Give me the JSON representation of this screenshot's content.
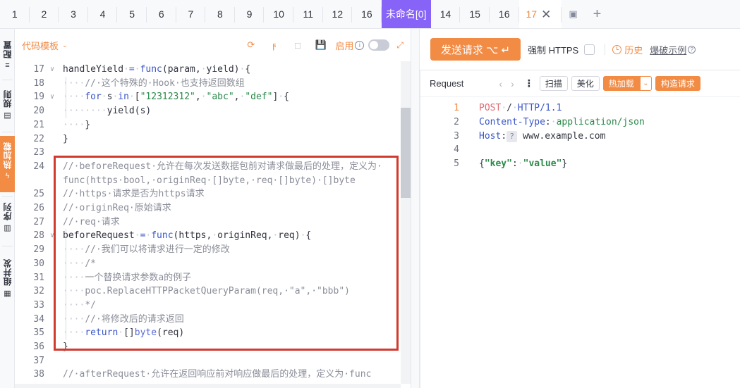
{
  "tabs": {
    "numbered": [
      "1",
      "2",
      "3",
      "4",
      "5",
      "6",
      "7",
      "8",
      "9",
      "10",
      "11",
      "12",
      "16"
    ],
    "named": "未命名[0]",
    "after": [
      "14",
      "15",
      "16"
    ],
    "active": "17",
    "close_glyph": "✕"
  },
  "sidenav": [
    {
      "label": "配置",
      "icon": "sliders-icon"
    },
    {
      "label": "规则",
      "icon": "clipboard-icon"
    },
    {
      "label": "热加载",
      "icon": "bolt-icon",
      "active": true
    },
    {
      "label": "序列",
      "icon": "layers-icon"
    },
    {
      "label": "组并发",
      "icon": "grid-icon"
    }
  ],
  "editor": {
    "title": "代码模板",
    "enable_label": "启用",
    "lines": [
      {
        "n": "17",
        "tokens": [
          [
            "plain",
            "handleYield"
          ],
          [
            "ws",
            "·"
          ],
          [
            "op",
            "="
          ],
          [
            "ws",
            "·"
          ],
          [
            "kw",
            "func"
          ],
          [
            "plain",
            "(param,"
          ],
          [
            "ws",
            "·"
          ],
          [
            "plain",
            "yield)"
          ],
          [
            "ws",
            "·"
          ],
          [
            "plain",
            "{"
          ]
        ]
      },
      {
        "n": "18",
        "tokens": [
          [
            "ws",
            "····"
          ],
          [
            "cm",
            "//·这个特殊的·Hook·也支持返回数组"
          ]
        ]
      },
      {
        "n": "19",
        "tokens": [
          [
            "ws",
            "····"
          ],
          [
            "kw",
            "for"
          ],
          [
            "ws",
            "·"
          ],
          [
            "plain",
            "s"
          ],
          [
            "ws",
            "·"
          ],
          [
            "kw",
            "in"
          ],
          [
            "ws",
            "·"
          ],
          [
            "plain",
            "["
          ],
          [
            "str",
            "\"12312312\""
          ],
          [
            "plain",
            ","
          ],
          [
            "ws",
            "·"
          ],
          [
            "str",
            "\"abc\""
          ],
          [
            "plain",
            ","
          ],
          [
            "ws",
            "·"
          ],
          [
            "str",
            "\"def\""
          ],
          [
            "plain",
            "]"
          ],
          [
            "ws",
            "·"
          ],
          [
            "plain",
            "{"
          ]
        ]
      },
      {
        "n": "20",
        "tokens": [
          [
            "ws",
            "········"
          ],
          [
            "plain",
            "yield(s)"
          ]
        ]
      },
      {
        "n": "21",
        "tokens": [
          [
            "ws",
            "····"
          ],
          [
            "plain",
            "}"
          ]
        ]
      },
      {
        "n": "22",
        "tokens": [
          [
            "plain",
            "}"
          ]
        ]
      },
      {
        "n": "23",
        "tokens": []
      },
      {
        "n": "24",
        "tokens": [
          [
            "cm",
            "//·beforeRequest·允许在每次发送数据包前对请求做最后的处理，定义为·"
          ]
        ]
      },
      {
        "n": "",
        "tokens": [
          [
            "cm",
            "func(https·bool,·originReq·[]byte,·req·[]byte)·[]byte"
          ]
        ]
      },
      {
        "n": "25",
        "tokens": [
          [
            "cm",
            "//·https·请求是否为https请求"
          ]
        ]
      },
      {
        "n": "26",
        "tokens": [
          [
            "cm",
            "//·originReq·原始请求"
          ]
        ]
      },
      {
        "n": "27",
        "tokens": [
          [
            "cm",
            "//·req·请求"
          ]
        ]
      },
      {
        "n": "28",
        "tokens": [
          [
            "plain",
            "beforeRequest"
          ],
          [
            "ws",
            "·"
          ],
          [
            "op",
            "="
          ],
          [
            "ws",
            "·"
          ],
          [
            "kw",
            "func"
          ],
          [
            "plain",
            "(https,"
          ],
          [
            "ws",
            "·"
          ],
          [
            "plain",
            "originReq,"
          ],
          [
            "ws",
            "·"
          ],
          [
            "plain",
            "req)"
          ],
          [
            "ws",
            "·"
          ],
          [
            "plain",
            "{"
          ]
        ]
      },
      {
        "n": "29",
        "tokens": [
          [
            "ws",
            "····"
          ],
          [
            "cm",
            "//·我们可以将请求进行一定的修改"
          ]
        ]
      },
      {
        "n": "30",
        "tokens": [
          [
            "ws",
            "····"
          ],
          [
            "cm",
            "/*"
          ]
        ]
      },
      {
        "n": "31",
        "tokens": [
          [
            "ws",
            "····"
          ],
          [
            "cm",
            "一个替换请求参数a的例子"
          ]
        ]
      },
      {
        "n": "32",
        "tokens": [
          [
            "ws",
            "····"
          ],
          [
            "cm",
            "poc.ReplaceHTTPPacketQueryParam(req,·\"a\",·\"bbb\")"
          ]
        ]
      },
      {
        "n": "33",
        "tokens": [
          [
            "ws",
            "····"
          ],
          [
            "cm",
            "*/"
          ]
        ]
      },
      {
        "n": "34",
        "tokens": [
          [
            "ws",
            "····"
          ],
          [
            "cm",
            "//·将修改后的请求返回"
          ]
        ]
      },
      {
        "n": "35",
        "tokens": [
          [
            "ws",
            "····"
          ],
          [
            "kw",
            "return"
          ],
          [
            "ws",
            "·"
          ],
          [
            "plain",
            "[]"
          ],
          [
            "ty",
            "byte"
          ],
          [
            "plain",
            "(req)"
          ]
        ]
      },
      {
        "n": "36",
        "tokens": [
          [
            "plain",
            "}"
          ]
        ]
      },
      {
        "n": "37",
        "tokens": []
      },
      {
        "n": "38",
        "tokens": [
          [
            "cm",
            "//·afterRequest·允许在返回响应前对响应做最后的处理，定义为·func"
          ]
        ]
      }
    ]
  },
  "request_panel": {
    "send_label": "发送请求 ⌥ ↵",
    "force_https_label": "强制 HTTPS",
    "history_label": "历史",
    "example_label": "爆破示例",
    "card_title": "Request",
    "buttons": [
      "扫描",
      "美化"
    ],
    "hot_load_label": "热加载",
    "build_label": "构造请求",
    "lines": [
      {
        "n": "1",
        "cur": true,
        "tokens": [
          [
            "r-method",
            "POST"
          ],
          [
            "ws",
            "·"
          ],
          [
            "plain",
            "/"
          ],
          [
            "ws",
            "·"
          ],
          [
            "r-http",
            "HTTP/1.1"
          ]
        ]
      },
      {
        "n": "2",
        "tokens": [
          [
            "r-hdr",
            "Content-Type"
          ],
          [
            "plain",
            ":"
          ],
          [
            "ws",
            "·"
          ],
          [
            "r-val",
            "application/json"
          ]
        ]
      },
      {
        "n": "3",
        "tokens": [
          [
            "r-hdr",
            "Host"
          ],
          [
            "plain",
            ":"
          ],
          [
            "r-q",
            "?"
          ],
          [
            "plain",
            " www.example.com"
          ]
        ]
      },
      {
        "n": "4",
        "tokens": []
      },
      {
        "n": "5",
        "tokens": [
          [
            "plain",
            "{"
          ],
          [
            "r-key",
            "\"key\""
          ],
          [
            "plain",
            ":"
          ],
          [
            "ws",
            "·"
          ],
          [
            "r-key",
            "\"value\""
          ],
          [
            "plain",
            "}"
          ]
        ]
      }
    ]
  }
}
